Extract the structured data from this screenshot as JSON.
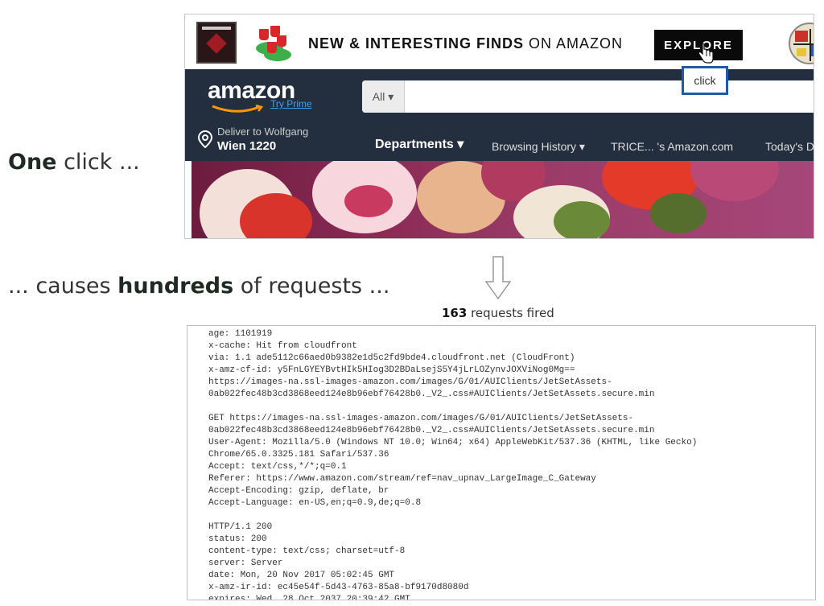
{
  "captions": {
    "one_bold": "One",
    "one_rest": " click ...",
    "causes_pre": "... causes ",
    "causes_bold": "hundreds",
    "causes_rest": " of requests ..."
  },
  "amazon": {
    "banner": {
      "text_bold": "NEW & INTERESTING FINDS",
      "text_rest": " ON AMAZON",
      "explore_label": "EXPLORE"
    },
    "logo_text": "amazon",
    "try_prime": "Try Prime",
    "search_category": "All ▾",
    "deliver_line1": "Deliver to Wolfgang",
    "deliver_line2": "Wien 1220",
    "departments": "Departments ▾",
    "nav_links": [
      "Browsing History ▾",
      "TRICE...  's Amazon.com",
      "Today's D"
    ]
  },
  "click_tooltip": "click",
  "requests": {
    "count": "163",
    "suffix": " requests fired"
  },
  "log_lines": [
    "age: 1101919",
    "x-cache: Hit from cloudfront",
    "via: 1.1 ade5112c66aed0b9382e1d5c2fd9bde4.cloudfront.net (CloudFront)",
    "x-amz-cf-id: y5FnLGYEYBvtHIk5HIog3D2BDaLsejS5Y4jLrLOZynvJOXViNog0Mg==",
    "https://images-na.ssl-images-amazon.com/images/G/01/AUIClients/JetSetAssets-",
    "0ab022fec48b3cd3868eed124e8b96ebf76428b0._V2_.css#AUIClients/JetSetAssets.secure.min",
    "",
    "GET https://images-na.ssl-images-amazon.com/images/G/01/AUIClients/JetSetAssets-",
    "0ab022fec48b3cd3868eed124e8b96ebf76428b0._V2_.css#AUIClients/JetSetAssets.secure.min",
    "User-Agent: Mozilla/5.0 (Windows NT 10.0; Win64; x64) AppleWebKit/537.36 (KHTML, like Gecko)",
    "Chrome/65.0.3325.181 Safari/537.36",
    "Accept: text/css,*/*;q=0.1",
    "Referer: https://www.amazon.com/stream/ref=nav_upnav_LargeImage_C_Gateway",
    "Accept-Encoding: gzip, deflate, br",
    "Accept-Language: en-US,en;q=0.9,de;q=0.8",
    "",
    "HTTP/1.1 200",
    "status: 200",
    "content-type: text/css; charset=utf-8",
    "server: Server",
    "date: Mon, 20 Nov 2017 05:02:45 GMT",
    "x-amz-ir-id: ec45e54f-5d43-4763-85a8-bf9170d8080d",
    "expires: Wed, 28 Oct 2037 20:39:42 GMT"
  ]
}
